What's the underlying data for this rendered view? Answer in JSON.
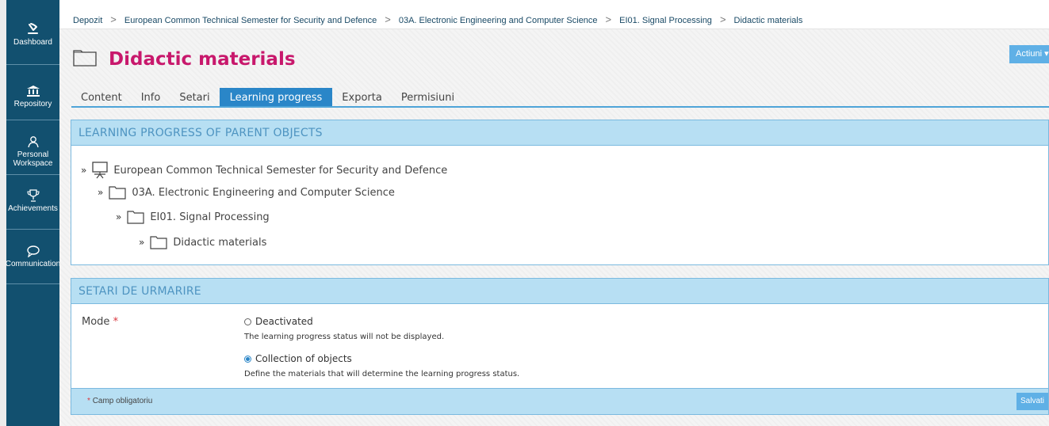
{
  "sidebar": {
    "items": [
      {
        "label": "Dashboard",
        "icon": "dashboard-icon"
      },
      {
        "label": "Repository",
        "icon": "bank-icon"
      },
      {
        "label": "Personal Workspace",
        "icon": "person-icon"
      },
      {
        "label": "Achievements",
        "icon": "trophy-icon"
      },
      {
        "label": "Communication",
        "icon": "chat-icon"
      }
    ],
    "background": "#12506f"
  },
  "breadcrumb": [
    "Depozit",
    "European Common Technical Semester for Security and Defence",
    "03A. Electronic Engineering and Computer Science",
    "EI01. Signal Processing",
    "Didactic materials"
  ],
  "page": {
    "title": "Didactic materials",
    "title_color": "#c8186c",
    "actions_label": "Actiuni ▾"
  },
  "tabs": [
    {
      "label": "Content",
      "active": false
    },
    {
      "label": "Info",
      "active": false
    },
    {
      "label": "Setari",
      "active": false
    },
    {
      "label": "Learning progress",
      "active": true
    },
    {
      "label": "Exporta",
      "active": false
    },
    {
      "label": "Permisiuni",
      "active": false
    }
  ],
  "parents_panel": {
    "title": "Learning progress of parent objects",
    "tree": [
      {
        "marker": "»",
        "icon": "course-board-icon",
        "name": "European Common Technical Semester for Security and Defence"
      },
      {
        "marker": "»",
        "icon": "folder-icon",
        "name": "03A. Electronic Engineering and Computer Science"
      },
      {
        "marker": "»",
        "icon": "folder-icon",
        "name": "EI01. Signal Processing"
      },
      {
        "marker": "»",
        "icon": "folder-icon",
        "name": "Didactic materials"
      }
    ]
  },
  "tracking_panel": {
    "title": "Setari de urmarire",
    "mode_label": "Mode",
    "required_mark": "*",
    "options": [
      {
        "label": "Deactivated",
        "description": "The learning progress status will not be displayed.",
        "selected": false
      },
      {
        "label": "Collection of objects",
        "description": "Define the materials that will determine the learning progress status.",
        "selected": true
      }
    ],
    "footer_note": "Camp obligatoriu",
    "save_label": "Salvati"
  },
  "colors": {
    "accent": "#2a86c8",
    "panel_header": "#b7dff3",
    "button": "#5fb0e6"
  }
}
